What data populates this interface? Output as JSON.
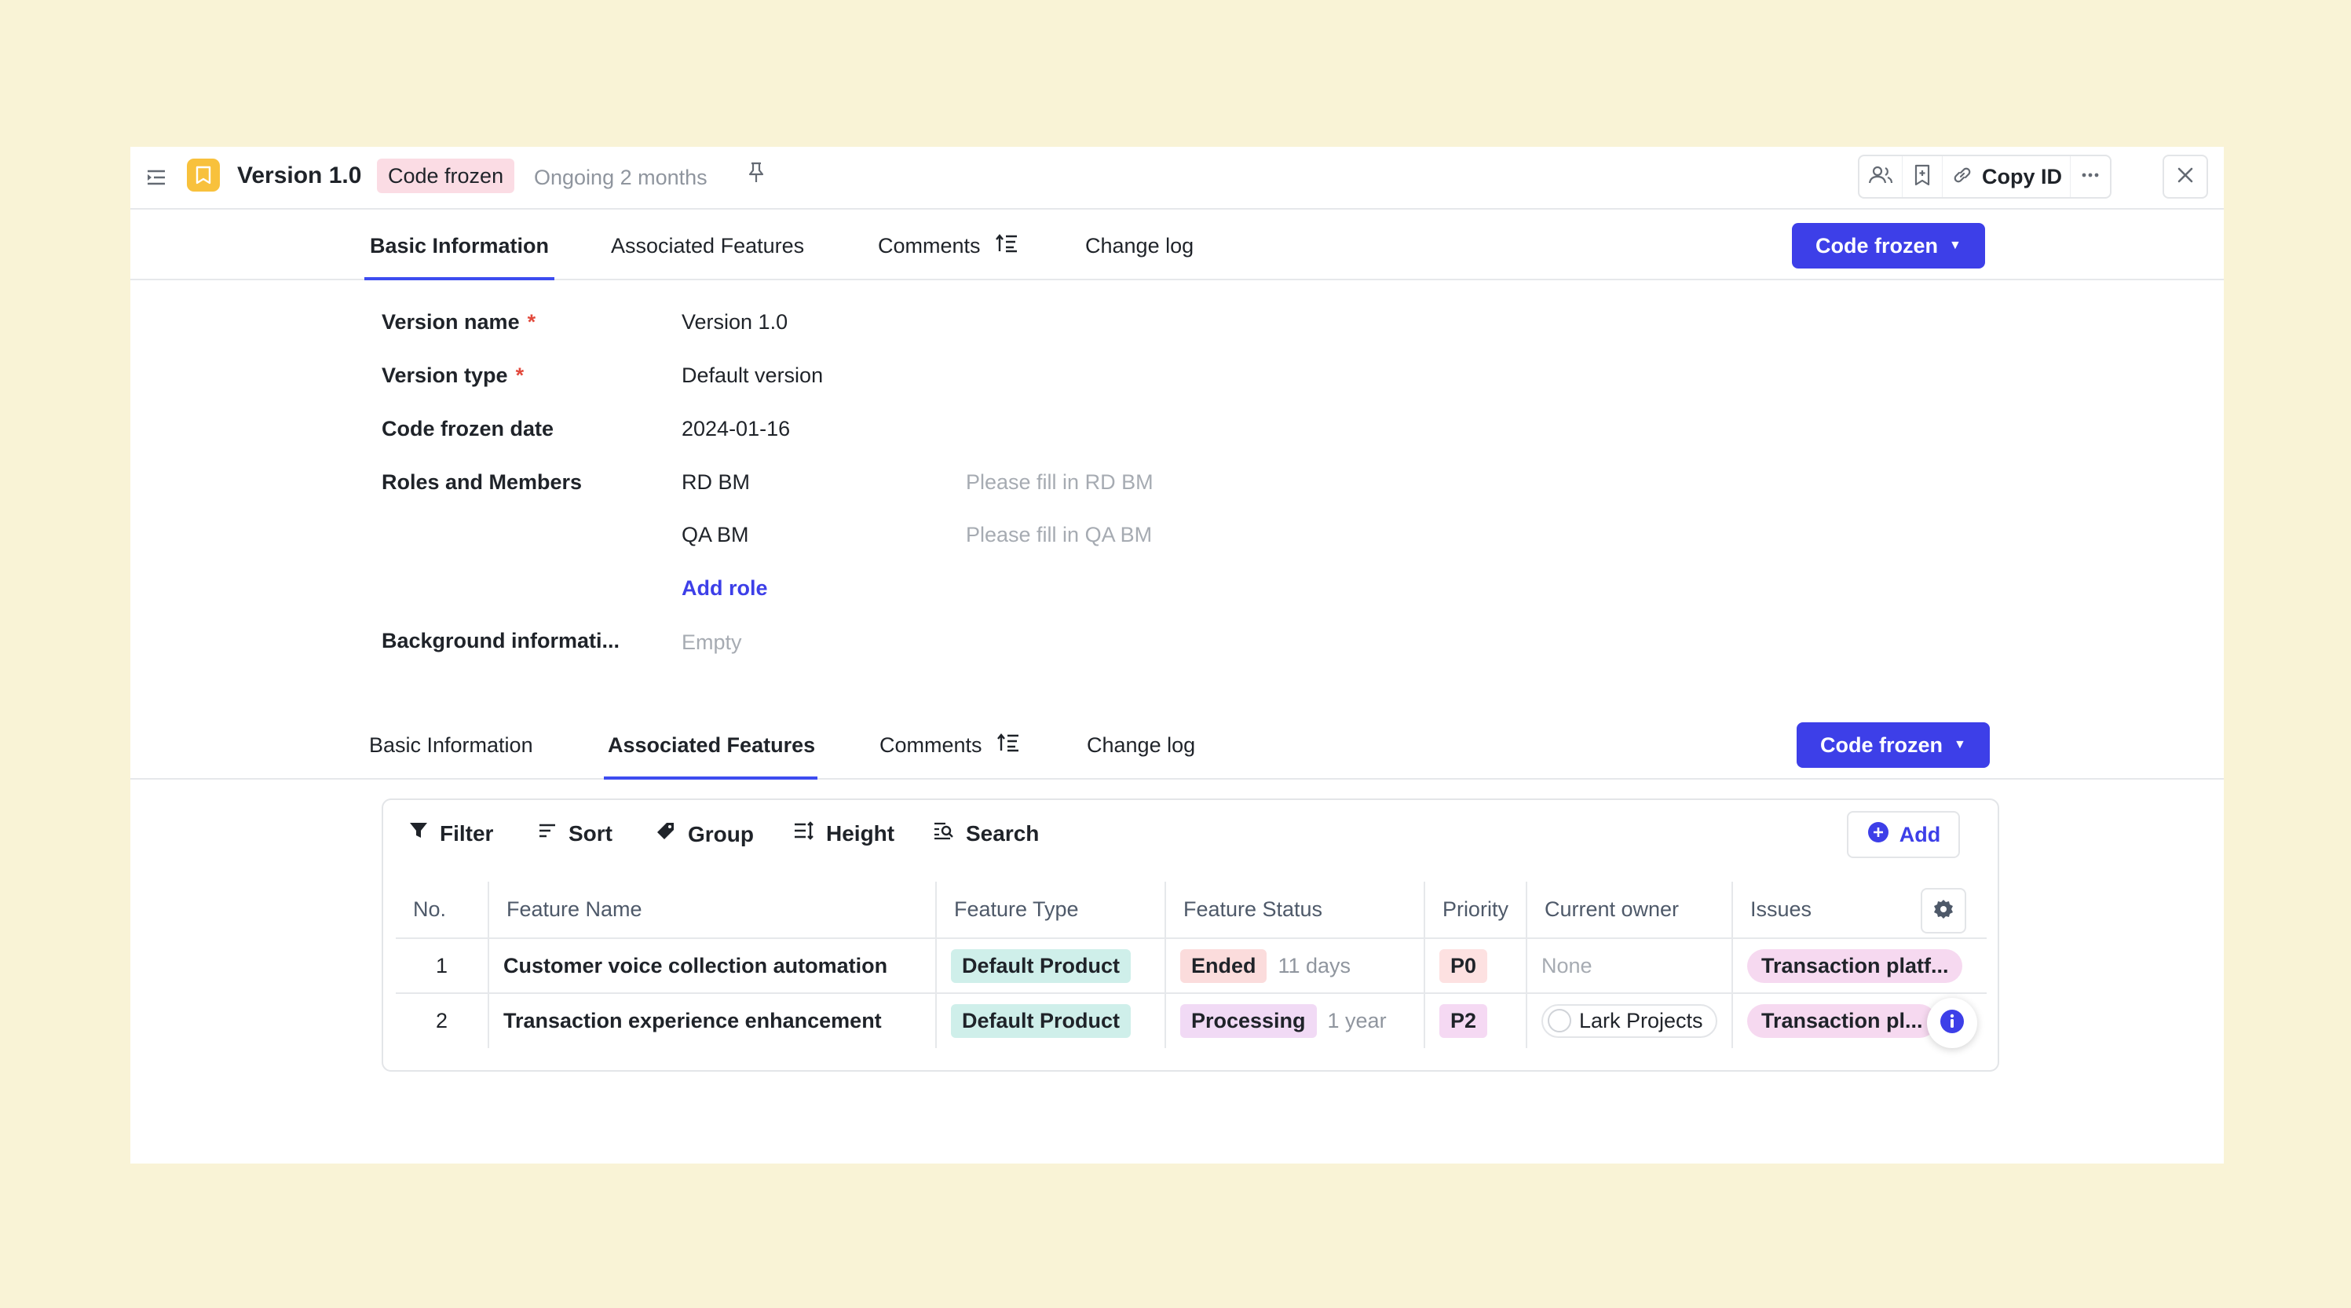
{
  "header": {
    "title": "Version 1.0",
    "status_tag": "Code frozen",
    "ongoing": "Ongoing 2 months",
    "copy_id": "Copy ID",
    "icons": [
      "collapse-sidebar-icon",
      "version-bookmark-icon",
      "pin-icon",
      "members-icon",
      "bookmark-icon",
      "link-icon",
      "more-icon",
      "close-icon"
    ]
  },
  "tabs_top": {
    "items": [
      "Basic Information",
      "Associated Features",
      "Comments",
      "Change log"
    ],
    "active": "Basic Information",
    "status_button": "Code frozen"
  },
  "form": {
    "version_name_label": "Version name",
    "version_name_value": "Version 1.0",
    "version_type_label": "Version type",
    "version_type_value": "Default version",
    "required_mark": "*",
    "code_frozen_date_label": "Code frozen date",
    "code_frozen_date_value": "2024-01-16",
    "roles_label": "Roles and Members",
    "roles": [
      {
        "role": "RD BM",
        "placeholder": "Please fill in RD BM"
      },
      {
        "role": "QA BM",
        "placeholder": "Please fill in QA BM"
      }
    ],
    "add_role": "Add role",
    "background_label": "Background informati...",
    "background_value": "Empty"
  },
  "tabs_bottom": {
    "items": [
      "Basic Information",
      "Associated Features",
      "Comments",
      "Change log"
    ],
    "active": "Associated Features",
    "status_button": "Code frozen"
  },
  "toolbar": {
    "filter": "Filter",
    "sort": "Sort",
    "group": "Group",
    "height": "Height",
    "search": "Search",
    "add": "Add"
  },
  "table": {
    "columns": [
      "No.",
      "Feature Name",
      "Feature Type",
      "Feature Status",
      "Priority",
      "Current owner",
      "Issues"
    ],
    "rows": [
      {
        "no": "1",
        "name": "Customer voice collection automation",
        "type": "Default Product",
        "status": "Ended",
        "duration": "11 days",
        "priority": "P0",
        "owner": "None",
        "issue": "Transaction platf..."
      },
      {
        "no": "2",
        "name": "Transaction experience enhancement",
        "type": "Default Product",
        "status": "Processing",
        "duration": "1 year",
        "priority": "P2",
        "owner": "Lark Projects",
        "issue": "Transaction pl..."
      }
    ]
  },
  "colors": {
    "background": "#F9F3D6",
    "accent": "#3D3FE8",
    "status_tag": "#FBDCE4",
    "type_chip": "#CFEFEA",
    "version_icon": "#F8C13C"
  }
}
